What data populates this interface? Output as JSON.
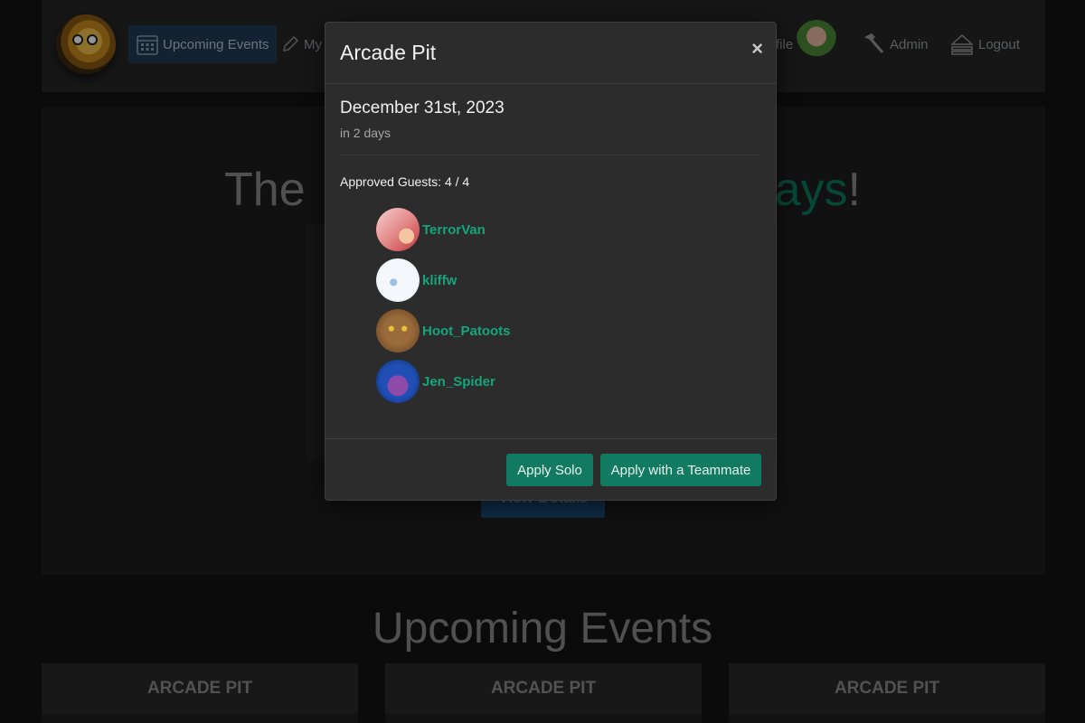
{
  "nav": {
    "items": [
      {
        "label": "Upcoming Events",
        "icon": "calendar-icon"
      },
      {
        "label": "My A",
        "icon": "pencil-icon"
      },
      {
        "label": "file",
        "icon": "profile-avatar"
      },
      {
        "label": "Admin",
        "icon": "hammer-icon"
      },
      {
        "label": "Logout",
        "icon": "eject-icon"
      }
    ]
  },
  "hero": {
    "title_start": "The",
    "title_accent": "ays",
    "title_end": "!",
    "button_label": "View Details"
  },
  "section_title": "Upcoming Events",
  "event_cards": [
    {
      "name": "ARCADE PIT"
    },
    {
      "name": "ARCADE PIT"
    },
    {
      "name": "ARCADE PIT"
    }
  ],
  "modal": {
    "title": "Arcade Pit",
    "close_glyph": "×",
    "date": "December 31st, 2023",
    "relative": "in 2 days",
    "approved_guests": "Approved Guests: 4 / 4",
    "guests": [
      {
        "name": "TerrorVan"
      },
      {
        "name": "kliffw"
      },
      {
        "name": "Hoot_Patoots"
      },
      {
        "name": "Jen_Spider"
      }
    ],
    "apply_solo_label": "Apply Solo",
    "apply_team_label": "Apply with a Teammate"
  },
  "colors": {
    "accent_green": "#16a57b",
    "button_green": "#127a60",
    "active_nav": "#1f3b57"
  }
}
